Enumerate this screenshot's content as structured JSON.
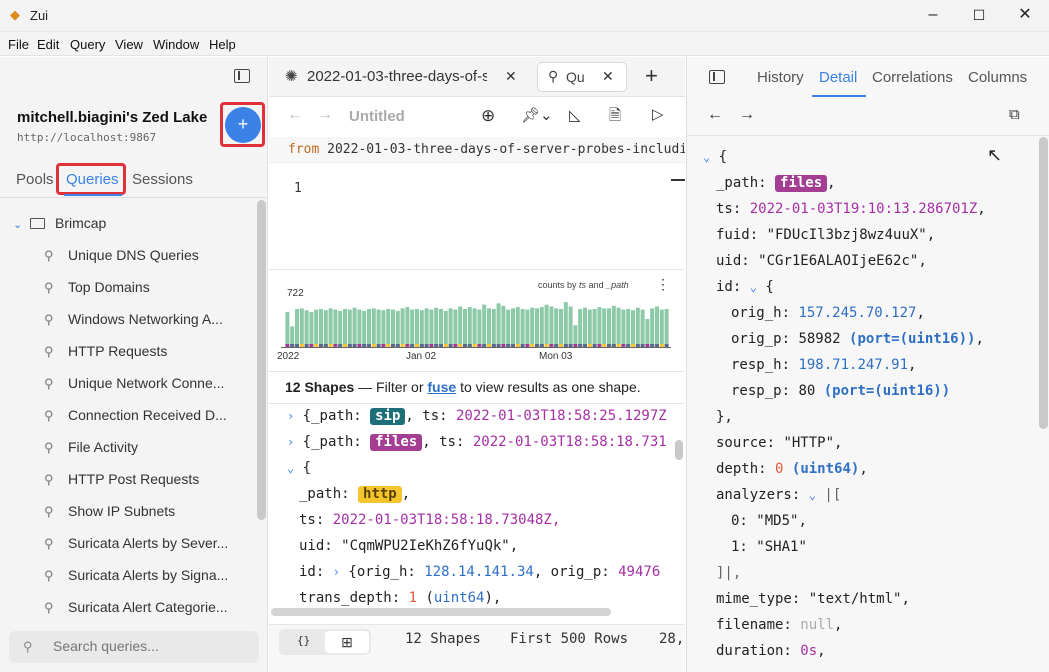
{
  "window": {
    "title": "Zui",
    "min": "–",
    "max": "☐",
    "close": "✕"
  },
  "menu": [
    "File",
    "Edit",
    "Query",
    "View",
    "Window",
    "Help"
  ],
  "sidebar": {
    "lake_name": "mitchell.biagini's Zed Lake",
    "lake_url": "http://localhost:9867",
    "add_label": "+",
    "tabs": [
      "Pools",
      "Queries",
      "Sessions"
    ],
    "folder": "Brimcap",
    "items": [
      "Unique DNS Queries",
      "Top Domains",
      "Windows Networking A...",
      "HTTP Requests",
      "Unique Network Conne...",
      "Connection Received D...",
      "File Activity",
      "HTTP Post Requests",
      "Show IP Subnets",
      "Suricata Alerts by Sever...",
      "Suricata Alerts by Signa...",
      "Suricata Alert Categorie..."
    ],
    "search_placeholder": "Search queries..."
  },
  "tabs": {
    "tab1_label": "2022-01-03-three-days-of-s",
    "tab2_label": "Qu",
    "close": "✕",
    "new": "+"
  },
  "toolbar": {
    "title": "Untitled"
  },
  "editor": {
    "from_kw": "from",
    "from_rest": "2022-01-03-three-days-of-server-probes-including",
    "line1": "1"
  },
  "chart_data": {
    "type": "bar",
    "title": "counts by ts and _path",
    "title_prefix": "counts by",
    "title_ts": "ts",
    "title_and": "and",
    "title_path": "_path",
    "ymax_label": "722",
    "x_labels": [
      "2022",
      "Jan 02",
      "Mon 03"
    ],
    "values": [
      560,
      330,
      610,
      620,
      590,
      560,
      600,
      610,
      590,
      620,
      600,
      580,
      610,
      600,
      630,
      600,
      580,
      610,
      620,
      600,
      590,
      610,
      600,
      580,
      620,
      640,
      600,
      610,
      590,
      620,
      600,
      630,
      610,
      580,
      620,
      600,
      650,
      610,
      640,
      620,
      600,
      680,
      620,
      610,
      700,
      660,
      600,
      620,
      640,
      610,
      600,
      630,
      620,
      640,
      680,
      650,
      620,
      610,
      720,
      650,
      350,
      610,
      630,
      600,
      610,
      640,
      620,
      620,
      660,
      630,
      600,
      610,
      590,
      630,
      600,
      450,
      620,
      650,
      600,
      610
    ]
  },
  "shapes": {
    "count_label": "12 Shapes",
    "rest1": " — Filter or ",
    "fuse": "fuse",
    "rest2": " to view results as one shape."
  },
  "results": {
    "r1_pre": "{_path: ",
    "r1_badge": "sip",
    "r1_mid": ", ts: ",
    "r1_ts": "2022-01-03T18:58:25.1297Z",
    "r2_pre": "{_path: ",
    "r2_badge": "files",
    "r2_mid": ", ts: ",
    "r2_ts": "2022-01-03T18:58:18.731",
    "r3": "{",
    "path_k": "_path: ",
    "path_badge": "http",
    "ts_k": "ts: ",
    "ts_v": "2022-01-03T18:58:18.73048Z,",
    "uid_k": "uid: ",
    "uid_v": "\"CqmWPU2IeKhZ6fYuQk\",",
    "id_k": "id: ",
    "id_v1": "{orig_h: ",
    "id_ip": "128.14.141.34",
    "id_v2": ", orig_p: ",
    "id_num": "49476",
    "td_k": "trans_depth: ",
    "td_n": "1",
    "td_t": "uint64"
  },
  "bottom": {
    "code_icon": "{}",
    "table_icon": "⊞",
    "shapes": "12 Shapes",
    "rows": "First 500 Rows",
    "more": "28,"
  },
  "right": {
    "tabs": [
      "History",
      "Detail",
      "Correlations",
      "Columns"
    ],
    "brace": "{",
    "path_k": "_path: ",
    "path_badge": "files",
    "ts_k": "ts: ",
    "ts_v": "2022-01-03T19:10:13.286701Z",
    "fuid_k": "fuid: ",
    "fuid_v": "\"FDUcIl3bzj8wz4uuX\"",
    "uid_k": "uid: ",
    "uid_v": "\"CGr1E6ALAOIjeE62c\"",
    "id_k": "id: ",
    "id_brace": "{",
    "oh_k": "orig_h: ",
    "oh_v": "157.245.70.127",
    "op_k": "orig_p: ",
    "op_v": "58982",
    "op_t": "(port=(uint16))",
    "rh_k": "resp_h: ",
    "rh_v": "198.71.247.91",
    "rp_k": "resp_p: ",
    "rp_v": "80",
    "rp_t": "(port=(uint16))",
    "close_brace": "},",
    "src_k": "source: ",
    "src_v": "\"HTTP\"",
    "depth_k": "depth: ",
    "depth_v": "0",
    "depth_t": "(uint64)",
    "an_k": "analyzers: ",
    "an_open": "|[",
    "an0_k": "0: ",
    "an0_v": "\"MD5\"",
    "an1_k": "1: ",
    "an1_v": "\"SHA1\"",
    "an_close": "]|,",
    "mime_k": "mime_type: ",
    "mime_v": "\"text/html\"",
    "fn_k": "filename: ",
    "fn_v": "null",
    "dur_k": "duration: ",
    "dur_v": "0s"
  }
}
